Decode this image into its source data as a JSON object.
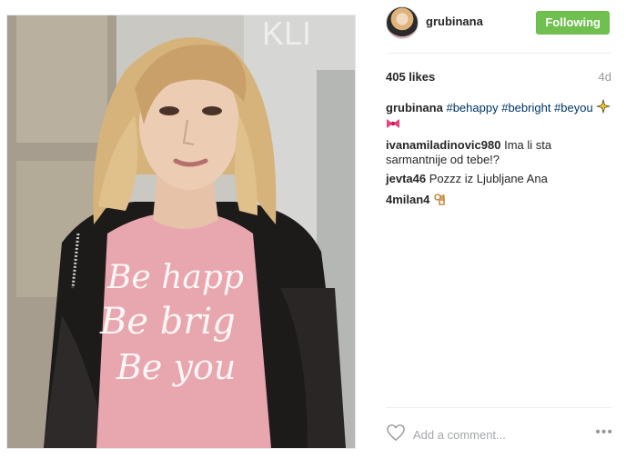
{
  "post": {
    "author": "grubinana",
    "follow_label": "Following",
    "likes": "405 likes",
    "time_ago": "4d",
    "caption": {
      "user": "grubinana",
      "tags": [
        "#behappy",
        "#bebright",
        "#beyou"
      ]
    },
    "comments": [
      {
        "user": "ivanamiladinovic980",
        "text": "Ima li sta sarmantnije od tebe!?"
      },
      {
        "user": "jevta46",
        "text": "Pozzz iz Ljubljane Ana"
      },
      {
        "user": "4milan4",
        "text": ""
      }
    ],
    "add_comment_placeholder": "Add a comment...",
    "more_label": "•••",
    "shirt_text": [
      "Be happ",
      "Be brig",
      "Be you"
    ]
  },
  "colors": {
    "follow_button": "#70c050",
    "hashtag": "#003569",
    "shirt": "#e8a6ae"
  },
  "icons": {
    "like": "heart-outline-icon",
    "more": "more-options-icon"
  }
}
